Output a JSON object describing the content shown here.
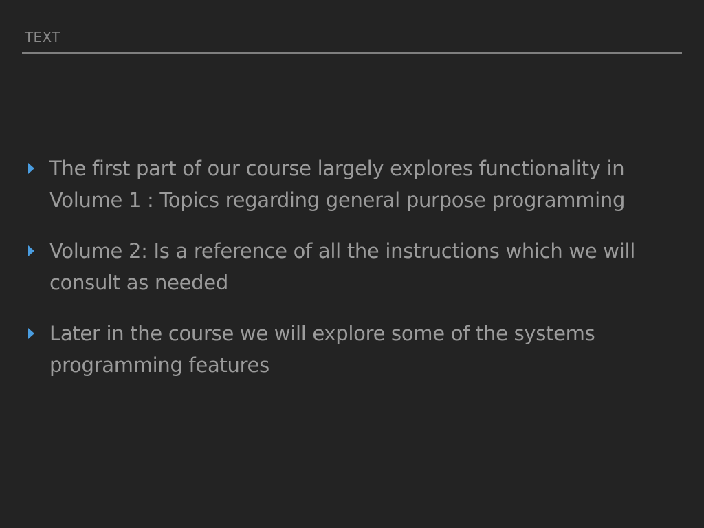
{
  "header": {
    "label": "TEXT"
  },
  "bullets": [
    {
      "text": "The first part of our course largely explores functionality in Volume 1 : Topics regarding general purpose programming"
    },
    {
      "text": "Volume 2: Is a reference of all the instructions which we will consult as needed"
    },
    {
      "text": "Later in the course we will explore some of the systems programming features"
    }
  ],
  "colors": {
    "background": "#232323",
    "text": "#9b9b9b",
    "header": "#8a8a8a",
    "rule": "#7f7f7f",
    "bullet_accent": "#4a9de0"
  },
  "icons": {
    "bullet": "triangle-right-icon"
  }
}
